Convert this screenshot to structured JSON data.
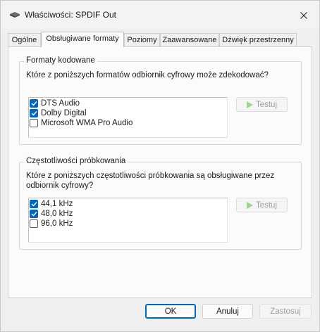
{
  "window": {
    "title": "Właściwości: SPDIF Out"
  },
  "tabs": [
    {
      "label": "Ogólne"
    },
    {
      "label": "Obsługiwane formaty"
    },
    {
      "label": "Poziomy"
    },
    {
      "label": "Zaawansowane"
    },
    {
      "label": "Dźwięk przestrzenny"
    }
  ],
  "formats": {
    "title": "Formaty kodowane",
    "question": "Które z poniższych formatów odbiornik cyfrowy może zdekodować?",
    "items": [
      {
        "label": "DTS Audio",
        "checked": true
      },
      {
        "label": "Dolby Digital",
        "checked": true
      },
      {
        "label": "Microsoft WMA Pro Audio",
        "checked": false
      }
    ],
    "test_label": "Testuj"
  },
  "rates": {
    "title": "Częstotliwości próbkowania",
    "question_line1": "Które z poniższych częstotliwości próbkowania są obsługiwane przez",
    "question_line2": "odbiornik cyfrowy?",
    "items": [
      {
        "label": "44,1 kHz",
        "checked": true
      },
      {
        "label": "48,0 kHz",
        "checked": true
      },
      {
        "label": "96,0 kHz",
        "checked": false
      }
    ],
    "test_label": "Testuj"
  },
  "footer": {
    "ok": "OK",
    "cancel": "Anuluj",
    "apply": "Zastosuj"
  },
  "colors": {
    "accent": "#0067c0",
    "play_icon": "#9dd58e"
  }
}
